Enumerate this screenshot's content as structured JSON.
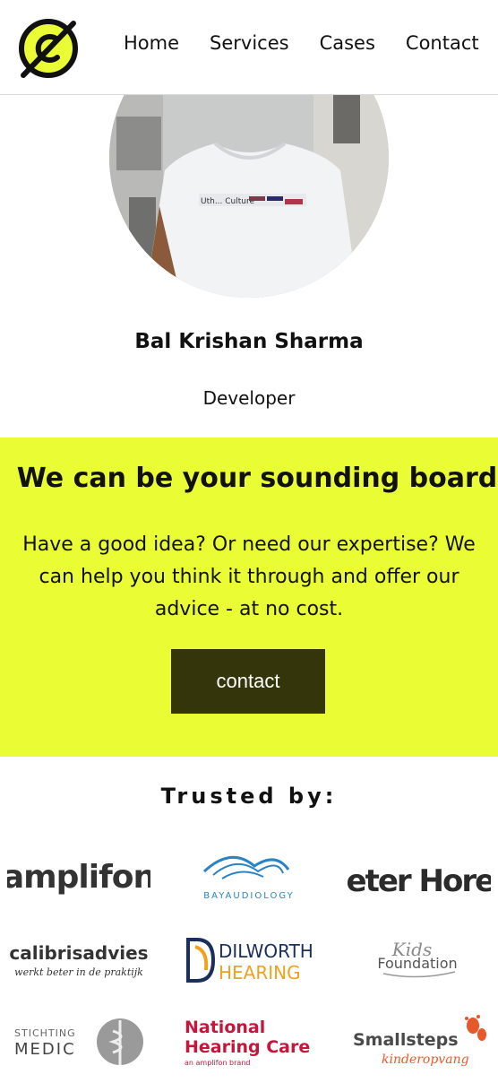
{
  "nav": {
    "items": [
      "Home",
      "Services",
      "Cases",
      "Contact"
    ]
  },
  "profile": {
    "name": "Bal Krishan Sharma",
    "role": "Developer",
    "shirt_text": "Uth... Culture"
  },
  "cta": {
    "title": "We can be your sounding board",
    "text": "Have a good idea? Or need our expertise? We can help you think it through and offer our advice - at no cost.",
    "button": "contact"
  },
  "trusted": {
    "title": "Trusted by:",
    "logos": {
      "amplifon": "amplifon",
      "bay_audiology": "BAYAUDIOLOGY",
      "beter_horen": "Beter Horen",
      "calibris_name": "calibrisadvies",
      "calibris_tagline": "werkt beter in de praktijk",
      "dilworth_1": "DILWORTH",
      "dilworth_2": "HEARING",
      "kids_1": "Kids",
      "kids_2": "Foundation",
      "medic_1": "STICHTING",
      "medic_2": "MEDIC",
      "nhc_1": "National",
      "nhc_2": "Hearing Care",
      "nhc_3": "an amplifon brand",
      "smallsteps_1": "Smallsteps",
      "smallsteps_2": "kinderopvang"
    }
  },
  "colors": {
    "accent": "#e9fc34",
    "button_bg": "#35350c",
    "logo_fill": "#e9fc34"
  }
}
